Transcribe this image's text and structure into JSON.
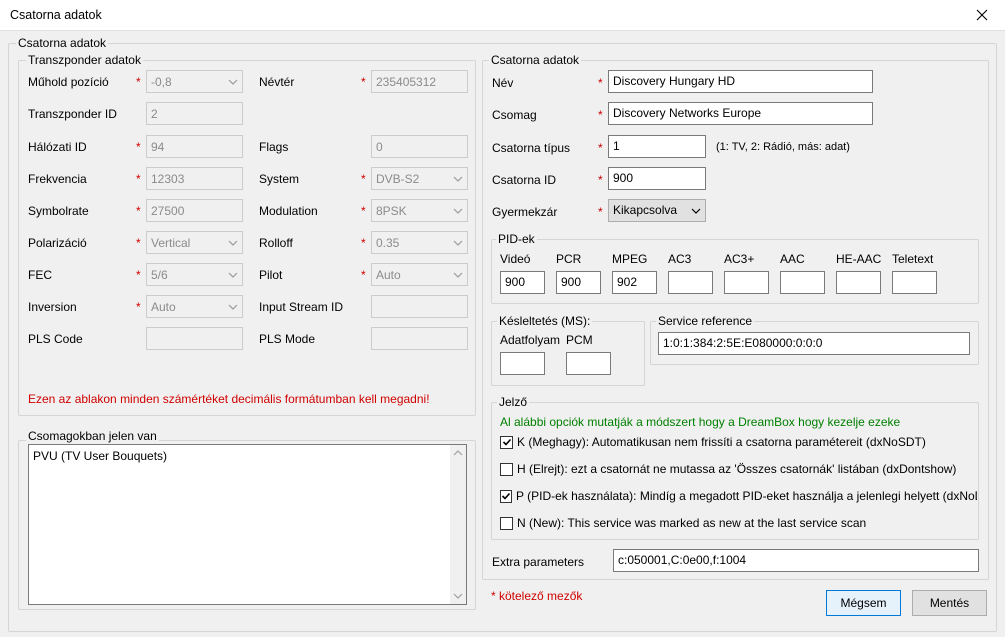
{
  "window": {
    "title": "Csatorna adatok"
  },
  "main_group": {
    "legend": "Csatorna adatok"
  },
  "transponder": {
    "legend": "Transzponder adatok",
    "muhold_label": "Műhold pozíció",
    "muhold_value": "-0,8",
    "namespace_label": "Névtér",
    "namespace_value": "235405312",
    "tid_label": "Transzponder ID",
    "tid_value": "2",
    "nid_label": "Hálózati ID",
    "nid_value": "94",
    "flags_label": "Flags",
    "flags_value": "0",
    "freq_label": "Frekvencia",
    "freq_value": "12303",
    "system_label": "System",
    "system_value": "DVB-S2",
    "sr_label": "Symbolrate",
    "sr_value": "27500",
    "mod_label": "Modulation",
    "mod_value": "8PSK",
    "pol_label": "Polarizáció",
    "pol_value": "Vertical",
    "rolloff_label": "Rolloff",
    "rolloff_value": "0.35",
    "fec_label": "FEC",
    "fec_value": "5/6",
    "pilot_label": "Pilot",
    "pilot_value": "Auto",
    "inv_label": "Inversion",
    "inv_value": "Auto",
    "isid_label": "Input Stream ID",
    "isid_value": "",
    "plscode_label": "PLS Code",
    "plscode_value": "",
    "plsmode_label": "PLS Mode",
    "plsmode_value": "",
    "warning": "Ezen az ablakon minden számértéket decimális formátumban kell megadni!"
  },
  "packages": {
    "legend": "Csomagokban jelen van",
    "items": [
      "PVU (TV User Bouquets)"
    ]
  },
  "channel": {
    "legend": "Csatorna adatok",
    "name_label": "Név",
    "name_value": "Discovery Hungary HD",
    "pkg_label": "Csomag",
    "pkg_value": "Discovery Networks Europe",
    "type_label": "Csatorna típus",
    "type_value": "1",
    "type_hint": "(1: TV, 2: Rádió, más: adat)",
    "id_label": "Csatorna ID",
    "id_value": "900",
    "lock_label": "Gyermekzár",
    "lock_value": "Kikapcsolva"
  },
  "pids": {
    "legend": "PID-ek",
    "columns": [
      {
        "label": "Videó",
        "value": "900"
      },
      {
        "label": "PCR",
        "value": "900"
      },
      {
        "label": "MPEG",
        "value": "902"
      },
      {
        "label": "AC3",
        "value": ""
      },
      {
        "label": "AC3+",
        "value": ""
      },
      {
        "label": "AAC",
        "value": ""
      },
      {
        "label": "HE-AAC",
        "value": ""
      },
      {
        "label": "Teletext",
        "value": ""
      }
    ]
  },
  "delay": {
    "legend": "Késleltetés (MS):",
    "stream_label": "Adatfolyam",
    "pcm_label": "PCM",
    "stream_value": "",
    "pcm_value": ""
  },
  "service": {
    "legend": "Service reference",
    "value": "1:0:1:384:2:5E:E080000:0:0:0"
  },
  "flags": {
    "legend": "Jelző",
    "info": "Al alábbi opciók mutatják a módszert hogy a DreamBox hogy kezelje ezeke",
    "items": [
      {
        "label": "K (Meghagy): Automatikusan nem frissíti a csatorna paramétereit (dxNoSDT)",
        "checked": true
      },
      {
        "label": "H (Elrejt): ezt a csatornát ne mutassa az 'Összes csatornák' listában (dxDontshow)",
        "checked": false
      },
      {
        "label": "P (PID-ek használata): Mindíg a megadott PID-eket használja a jelenlegi helyett (dxNoDVB)",
        "checked": true
      },
      {
        "label": "N (New): This service was marked as new at the last service scan",
        "checked": false
      }
    ]
  },
  "extra": {
    "label": "Extra parameters",
    "value": "c:050001,C:0e00,f:1004"
  },
  "footer": {
    "required_note": "* kötelező mezők",
    "cancel": "Mégsem",
    "save": "Mentés"
  },
  "required_mark": "*",
  "colors": {
    "required": "#d00000",
    "info": "#008000",
    "accent": "#0078d7"
  }
}
